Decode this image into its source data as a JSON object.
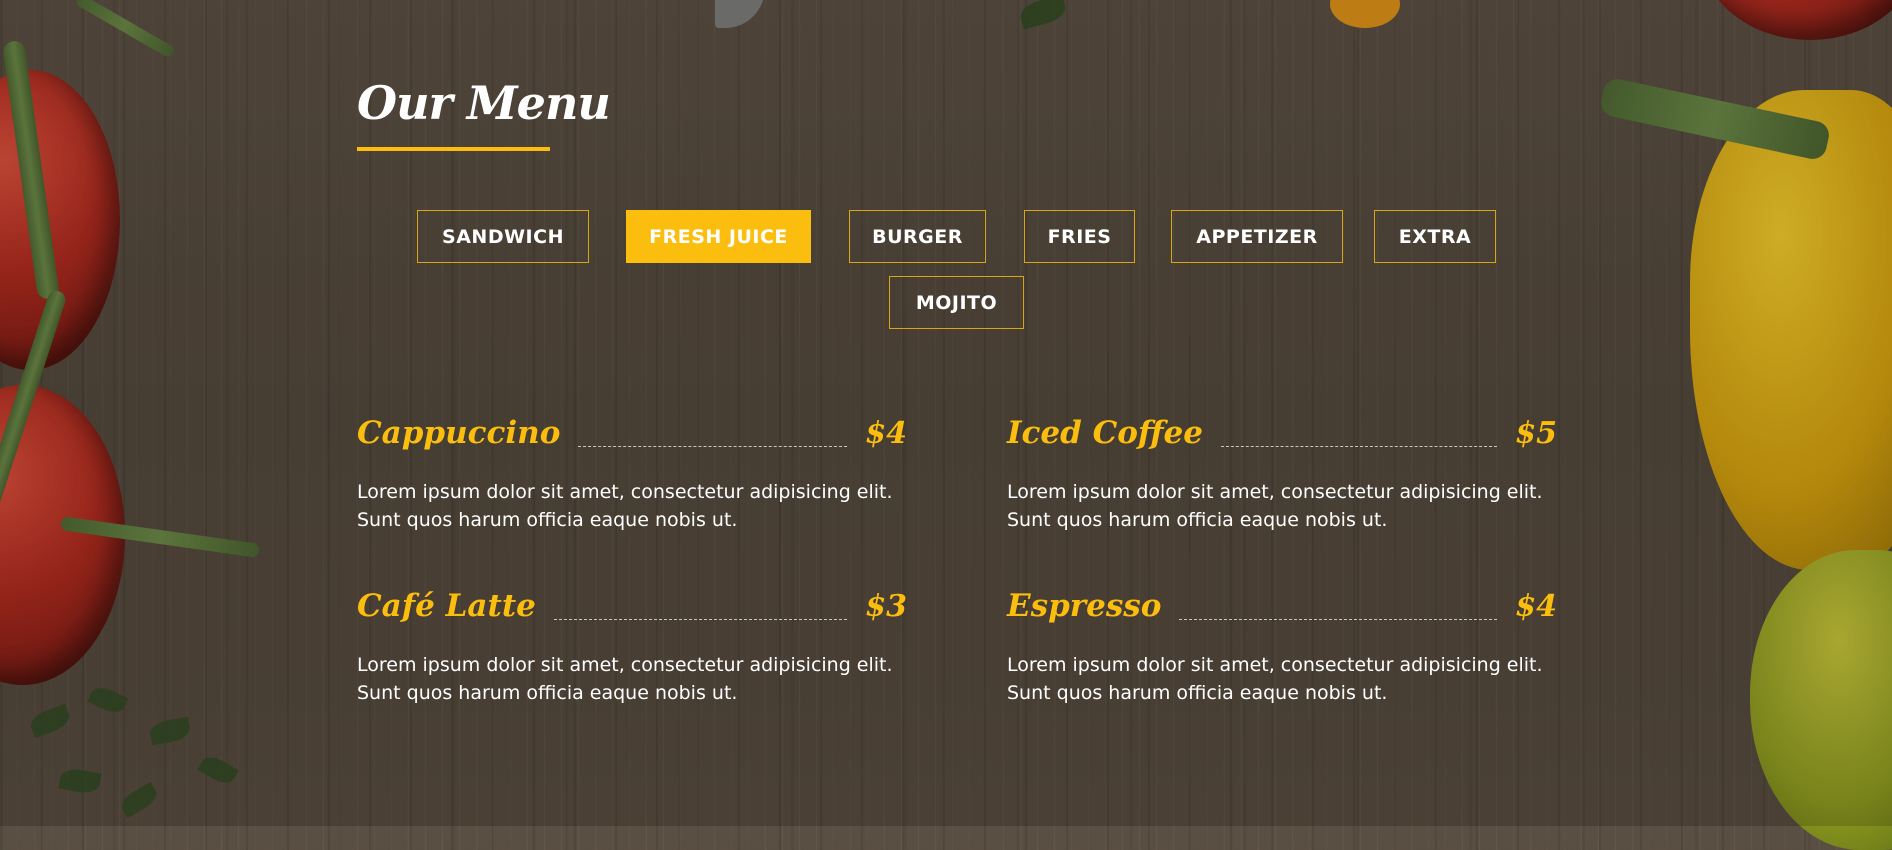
{
  "section": {
    "title": "Our Menu"
  },
  "filters": [
    {
      "label": "SANDWICH",
      "active": false
    },
    {
      "label": "FRESH JUICE",
      "active": true
    },
    {
      "label": "BURGER",
      "active": false
    },
    {
      "label": "FRIES",
      "active": false
    },
    {
      "label": "APPETIZER",
      "active": false
    },
    {
      "label": "EXTRA",
      "active": false
    },
    {
      "label": "MOJITO",
      "active": false
    }
  ],
  "items": [
    {
      "name": "Cappuccino",
      "price": "$4",
      "description": "Lorem ipsum dolor sit amet, consectetur adipisicing elit. Sunt quos harum officia eaque nobis ut."
    },
    {
      "name": "Iced Coffee",
      "price": "$5",
      "description": "Lorem ipsum dolor sit amet, consectetur adipisicing elit. Sunt quos harum officia eaque nobis ut."
    },
    {
      "name": "Café Latte",
      "price": "$3",
      "description": "Lorem ipsum dolor sit amet, consectetur adipisicing elit. Sunt quos harum officia eaque nobis ut."
    },
    {
      "name": "Espresso",
      "price": "$4",
      "description": "Lorem ipsum dolor sit amet, consectetur adipisicing elit. Sunt quos harum officia eaque nobis ut."
    }
  ],
  "colors": {
    "accent": "#fcbe0e",
    "text": "#ffffff",
    "background": "#574c40"
  }
}
